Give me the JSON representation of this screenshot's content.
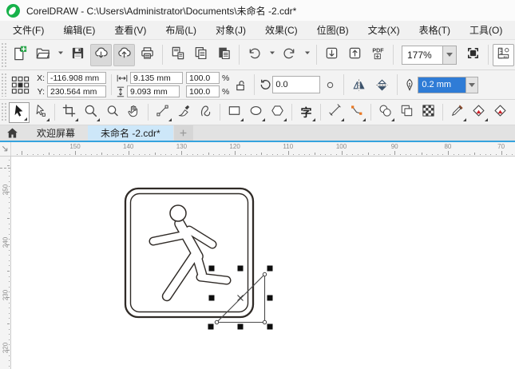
{
  "window": {
    "title": "CorelDRAW - C:\\Users\\Administrator\\Documents\\未命名 -2.cdr*"
  },
  "menu_bar": {
    "items": [
      {
        "label": "文件(F)"
      },
      {
        "label": "编辑(E)"
      },
      {
        "label": "查看(V)"
      },
      {
        "label": "布局(L)"
      },
      {
        "label": "对象(J)"
      },
      {
        "label": "效果(C)"
      },
      {
        "label": "位图(B)"
      },
      {
        "label": "文本(X)"
      },
      {
        "label": "表格(T)"
      },
      {
        "label": "工具(O)"
      }
    ]
  },
  "toolbar": {
    "zoom_level": "177%",
    "pdf_label": "PDF",
    "items": [
      {
        "type": "button",
        "name": "new-document-button",
        "icon": "new-doc"
      },
      {
        "type": "button",
        "name": "open-document-button",
        "icon": "open"
      },
      {
        "type": "button",
        "name": "open-dropdown",
        "icon": "caret",
        "narrow": true
      },
      {
        "type": "button",
        "name": "save-button",
        "icon": "save"
      },
      {
        "type": "button",
        "name": "import-button",
        "icon": "cloud-down",
        "pressed": true
      },
      {
        "type": "button",
        "name": "export-button",
        "icon": "cloud-up",
        "pressed": true
      },
      {
        "type": "button",
        "name": "print-button",
        "icon": "print"
      },
      {
        "type": "sep"
      },
      {
        "type": "button",
        "name": "cut-button",
        "icon": "cut"
      },
      {
        "type": "button",
        "name": "copy-button",
        "icon": "copy"
      },
      {
        "type": "button",
        "name": "paste-button",
        "icon": "paste"
      },
      {
        "type": "sep"
      },
      {
        "type": "button",
        "name": "undo-button",
        "icon": "undo"
      },
      {
        "type": "button",
        "name": "undo-dropdown",
        "icon": "caret",
        "narrow": true
      },
      {
        "type": "button",
        "name": "redo-button",
        "icon": "redo"
      },
      {
        "type": "button",
        "name": "redo-dropdown",
        "icon": "caret",
        "narrow": true
      },
      {
        "type": "sep"
      },
      {
        "type": "button",
        "name": "import-file-button",
        "icon": "import-box"
      },
      {
        "type": "button",
        "name": "export-file-button",
        "icon": "export-box"
      },
      {
        "type": "button",
        "name": "publish-pdf-button",
        "icon": "pdf"
      },
      {
        "type": "sep"
      },
      {
        "type": "zoom-combo",
        "name": "zoom-level-combo"
      },
      {
        "type": "button",
        "name": "fullscreen-preview-button",
        "icon": "fullscreen"
      },
      {
        "type": "sep"
      },
      {
        "type": "button",
        "name": "show-rulers-button",
        "icon": "rulers",
        "boxed": true
      }
    ]
  },
  "property_bar": {
    "x_label": "X:",
    "y_label": "Y:",
    "x_value": "-116.908 mm",
    "y_value": "230.564 mm",
    "width_value": "9.135 mm",
    "height_value": "9.093 mm",
    "scale_x": "100.0",
    "scale_y": "100.0",
    "percent": "%",
    "rotation": "0.0",
    "outline_width": "0.2 mm"
  },
  "toolbox": {
    "text_glyph": "字",
    "tools": [
      {
        "type": "tool",
        "name": "pick-tool",
        "icon": "pick",
        "selected": true,
        "flyout": true
      },
      {
        "type": "tool",
        "name": "shape-tool",
        "icon": "shape",
        "flyout": true
      },
      {
        "type": "sep"
      },
      {
        "type": "tool",
        "name": "crop-tool",
        "icon": "crop",
        "flyout": true
      },
      {
        "type": "tool",
        "name": "zoom-tool",
        "icon": "zoom",
        "flyout": true
      },
      {
        "type": "tool",
        "name": "magnifier-tool",
        "icon": "magnifier"
      },
      {
        "type": "tool",
        "name": "pan-tool",
        "icon": "pan"
      },
      {
        "type": "sep"
      },
      {
        "type": "tool",
        "name": "freehand-tool",
        "icon": "freehand",
        "flyout": true
      },
      {
        "type": "tool",
        "name": "artistic-media-tool",
        "icon": "artistic"
      },
      {
        "type": "tool",
        "name": "bspline-tool",
        "icon": "bspline"
      },
      {
        "type": "sep"
      },
      {
        "type": "tool",
        "name": "rectangle-tool",
        "icon": "rect",
        "flyout": true
      },
      {
        "type": "tool",
        "name": "ellipse-tool",
        "icon": "ellipse",
        "flyout": true
      },
      {
        "type": "tool",
        "name": "polygon-tool",
        "icon": "polygon",
        "flyout": true
      },
      {
        "type": "sep"
      },
      {
        "type": "tool",
        "name": "text-tool",
        "glyph": true,
        "flyout": true
      },
      {
        "type": "sep"
      },
      {
        "type": "tool",
        "name": "dimension-tool",
        "icon": "dimension",
        "flyout": true
      },
      {
        "type": "tool",
        "name": "connector-tool",
        "icon": "connector",
        "flyout": true
      },
      {
        "type": "sep"
      },
      {
        "type": "tool",
        "name": "drop-shadow-tool",
        "icon": "shadow",
        "flyout": true
      },
      {
        "type": "tool",
        "name": "transparency-tool",
        "icon": "transparency"
      },
      {
        "type": "tool",
        "name": "pattern-fill-tool",
        "icon": "pattern"
      },
      {
        "type": "sep"
      },
      {
        "type": "tool",
        "name": "color-eyedropper-tool",
        "icon": "eyedropper",
        "flyout": true
      },
      {
        "type": "tool",
        "name": "interactive-fill-tool",
        "icon": "fill",
        "flyout": true
      },
      {
        "type": "tool",
        "name": "smart-fill-tool",
        "icon": "fill"
      }
    ]
  },
  "tab_bar": {
    "tabs": [
      {
        "label": "欢迎屏幕",
        "active": false
      },
      {
        "label": "未命名 -2.cdr*",
        "active": true
      }
    ]
  },
  "rulers": {
    "horizontal_labels": [
      "150",
      "140",
      "130",
      "120",
      "110",
      "100",
      "90",
      "80",
      "70"
    ],
    "vertical_labels": [
      "250",
      "240",
      "230",
      "220"
    ],
    "unit": "mm"
  },
  "canvas": {
    "objects": [
      {
        "name": "exit-sign",
        "description": "rounded square sign, double outline, running man figure"
      },
      {
        "name": "triangle",
        "description": "right triangle object, selected",
        "selected": true,
        "handles": 8,
        "nodes": 3
      }
    ]
  },
  "colors": {
    "accent_blue": "#35a3de",
    "active_tab": "#cde7f9",
    "selection_highlight": "#2f7cd6",
    "icon_green": "#2fa84f",
    "node_orange": "#e87722",
    "fill_red": "#cc2229"
  }
}
